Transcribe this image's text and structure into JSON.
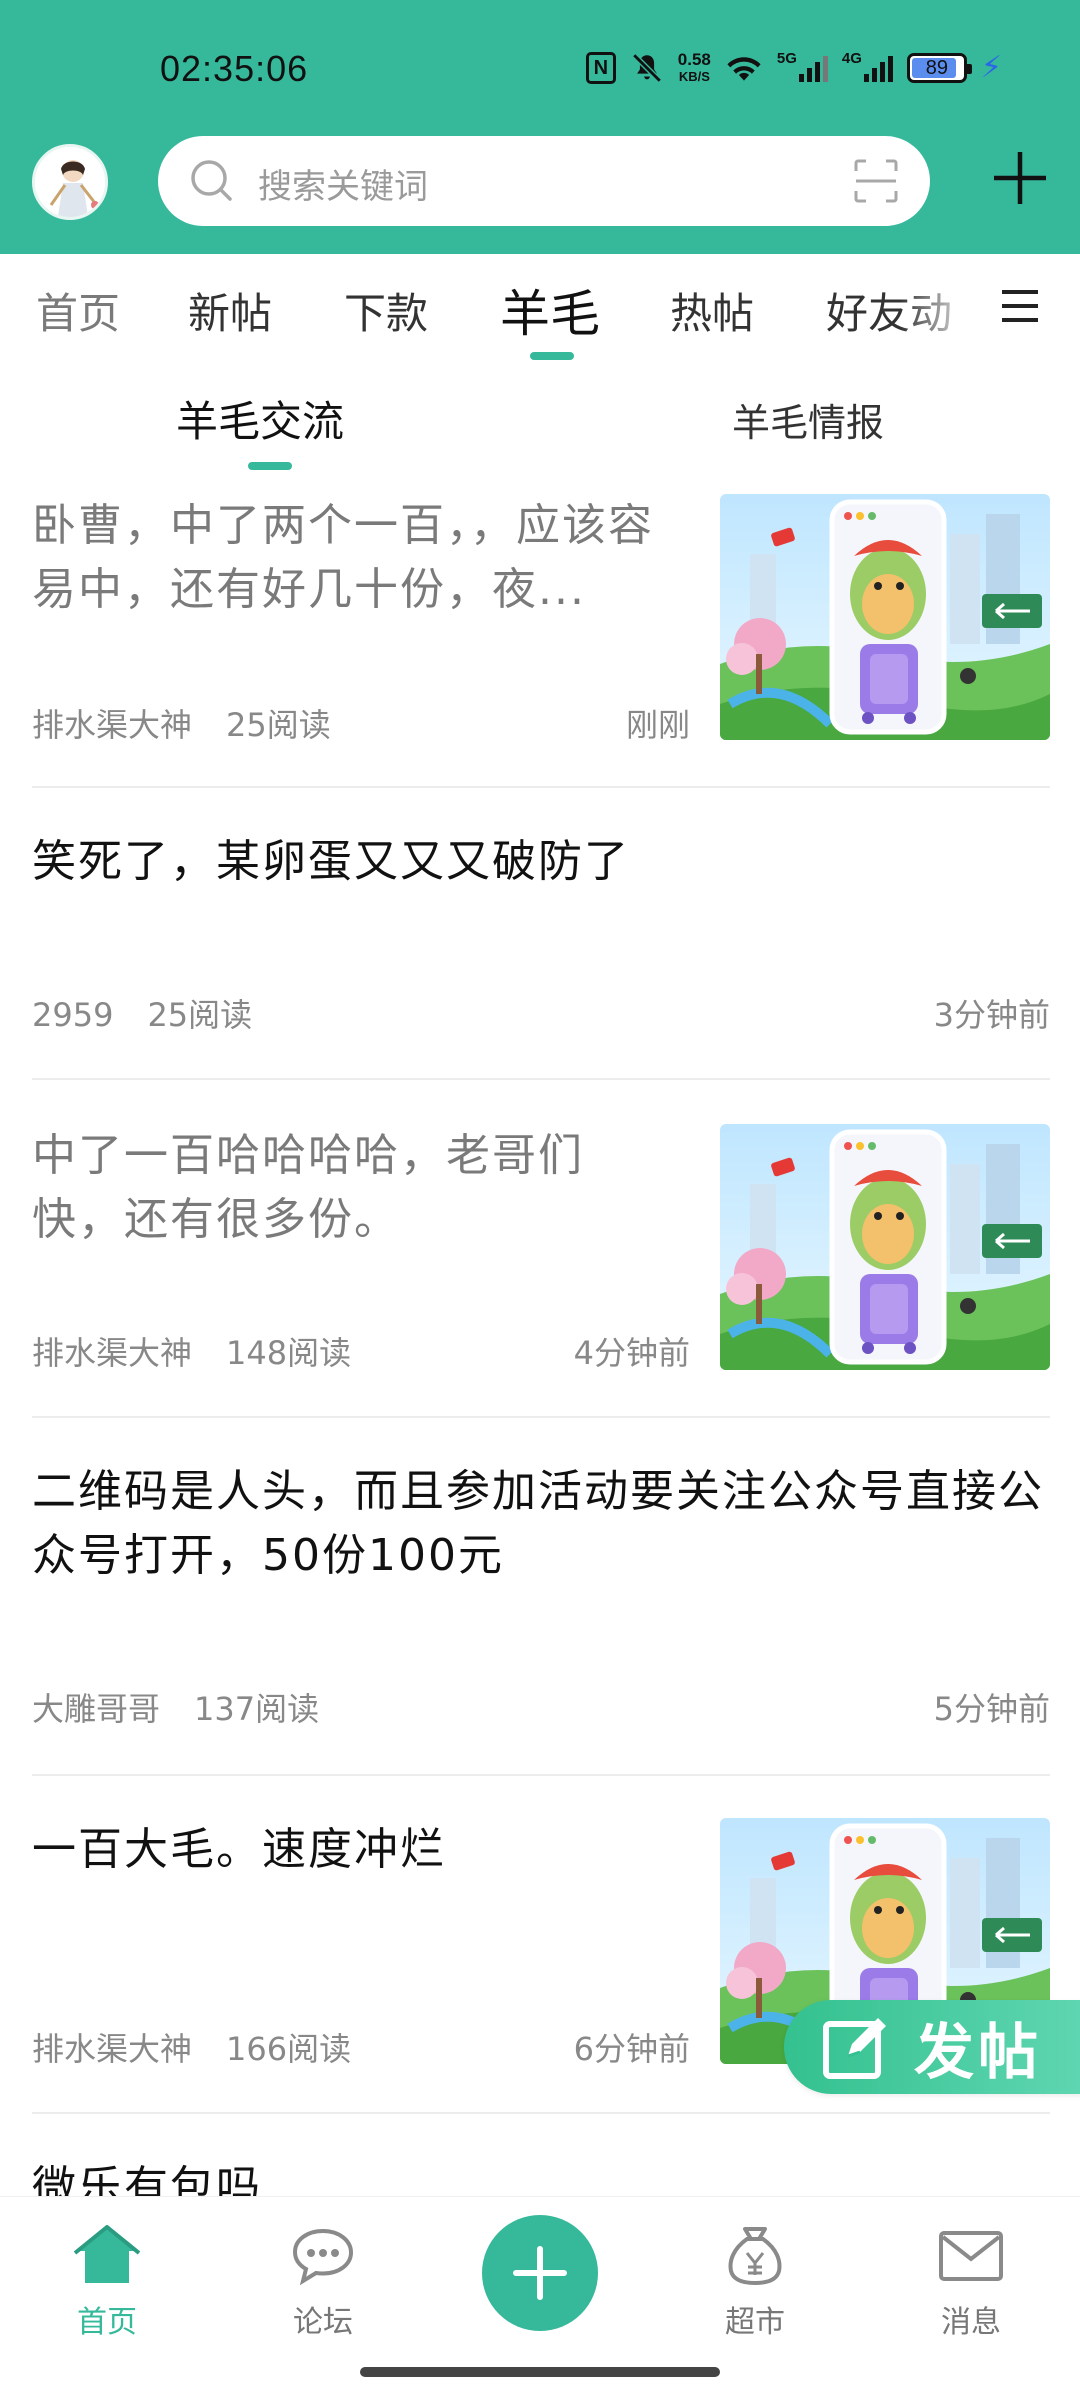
{
  "status_bar": {
    "time": "02:35:06",
    "nfc": "N",
    "net_speed_value": "0.58",
    "net_speed_unit": "KB/S",
    "sim1": "5G",
    "sim2": "4G",
    "battery": "89",
    "battery_level": 0.89
  },
  "header": {
    "search_placeholder": "搜索关键词",
    "accent_color": "#36b99b"
  },
  "tabs": [
    {
      "label": "首页"
    },
    {
      "label": "新帖"
    },
    {
      "label": "下款"
    },
    {
      "label": "羊毛",
      "active": true
    },
    {
      "label": "热帖"
    },
    {
      "label": "好友动"
    }
  ],
  "subtabs": [
    {
      "label": "羊毛交流",
      "active": true
    },
    {
      "label": "羊毛情报"
    }
  ],
  "posts": [
    {
      "title": "卧曹，中了两个一百，，应该容易中，还有好几十份，夜...",
      "author": "排水渠大神",
      "reads": "25阅读",
      "time": "刚刚",
      "thumbnail": "avocado-travel-image",
      "read": true
    },
    {
      "title": "笑死了，某卵蛋又又又破防了",
      "author": "2959",
      "reads": "25阅读",
      "time": "3分钟前"
    },
    {
      "title": "中了一百哈哈哈哈，老哥们快，还有很多份。",
      "author": "排水渠大神",
      "reads": "148阅读",
      "time": "4分钟前",
      "thumbnail": "avocado-travel-image",
      "read": true
    },
    {
      "title": "二维码是人头，而且参加活动要关注公众号直接公众号打开，50份100元",
      "author": "大雕哥哥",
      "reads": "137阅读",
      "time": "5分钟前"
    },
    {
      "title": "一百大毛。速度冲烂",
      "author": "排水渠大神",
      "reads": "166阅读",
      "time": "6分钟前",
      "thumbnail": "avocado-travel-image"
    },
    {
      "title": "微乐有包吗"
    }
  ],
  "fab": {
    "label": "发帖"
  },
  "bottom_nav": [
    {
      "label": "首页",
      "icon": "home-icon",
      "active": true
    },
    {
      "label": "论坛",
      "icon": "chat-icon"
    },
    {
      "label": "",
      "icon": "plus-icon"
    },
    {
      "label": "超市",
      "icon": "money-bag-icon"
    },
    {
      "label": "消息",
      "icon": "mail-icon"
    }
  ]
}
